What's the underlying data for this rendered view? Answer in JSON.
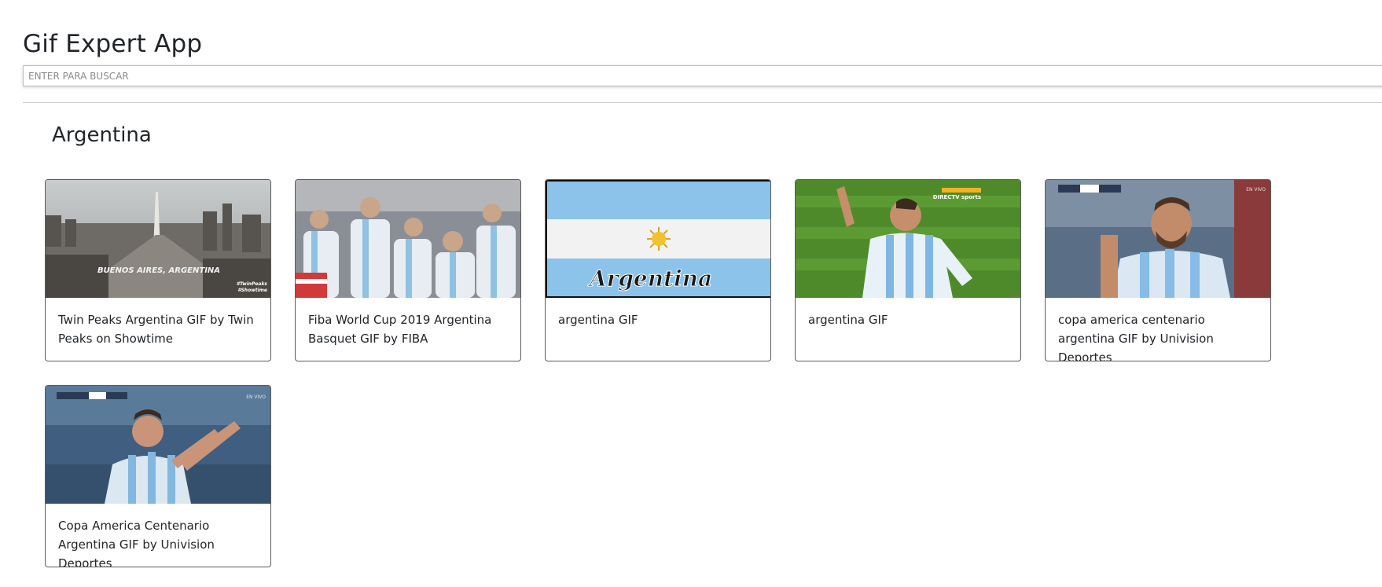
{
  "app": {
    "title": "Gif Expert App"
  },
  "search": {
    "placeholder": "ENTER PARA BUSCAR",
    "value": ""
  },
  "category": {
    "title": "Argentina"
  },
  "gifs": [
    {
      "title": "Twin Peaks Argentina GIF by Twin Peaks on Showtime",
      "overlay": "BUENOS AIRES, ARGENTINA",
      "tags": "#TwinPeaks\n#Showtime"
    },
    {
      "title": "Fiba World Cup 2019 Argentina Basquet GIF by FIBA"
    },
    {
      "title": "argentina GIF",
      "overlay": "Argentina"
    },
    {
      "title": "argentina GIF",
      "overlay": "DIRECTV sports"
    },
    {
      "title": "copa america centenario argentina GIF by Univision Deportes",
      "overlay": "EN VIVO"
    },
    {
      "title": "Copa America Centenario Argentina GIF by Univision Deportes",
      "overlay": "EN VIVO"
    }
  ]
}
